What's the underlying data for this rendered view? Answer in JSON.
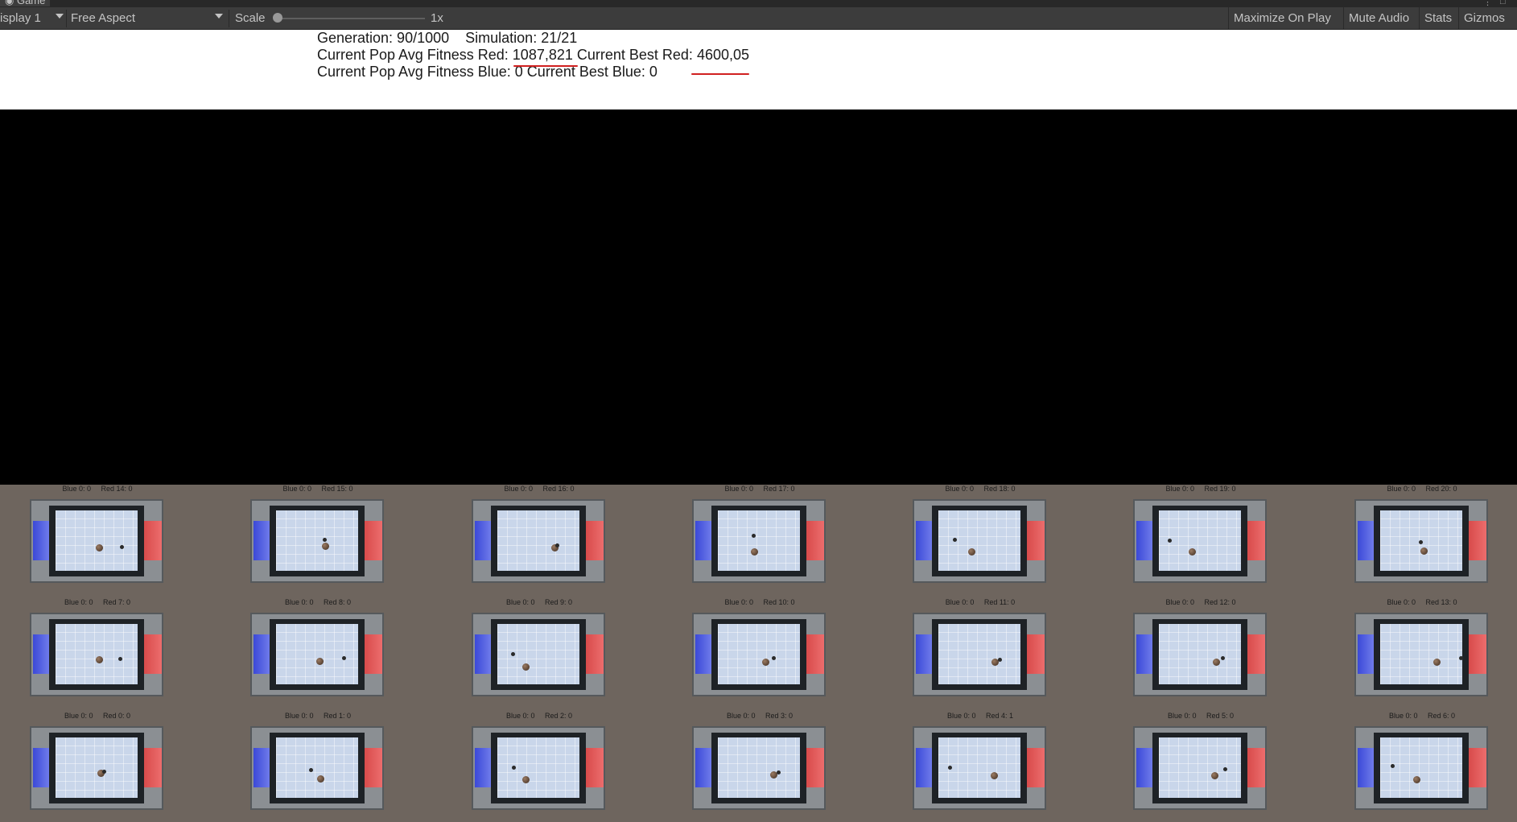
{
  "window": {
    "tab_title": "Game"
  },
  "toolbar": {
    "display": "isplay 1",
    "aspect": "Free Aspect",
    "scale_label": "Scale",
    "scale_value": "1x",
    "maximize_on_play": "Maximize On Play",
    "mute_audio": "Mute Audio",
    "stats": "Stats",
    "gizmos": "Gizmos"
  },
  "info": {
    "generation": "Generation: 90/1000",
    "simulation": "Simulation: 21/21",
    "line2_prefix": "Current Pop Avg Fitness Red: ",
    "avg_fitness_red": "1087,821",
    "line2_mid": " Current Best Red: ",
    "best_red": "4600,05",
    "line3": "Current Pop Avg Fitness Blue: 0 Current Best Blue: 0"
  },
  "colors": {
    "team_blue": "#3b49d8",
    "team_red": "#d84b4b",
    "annotation": "#d02020",
    "arena_bg": "#6e655e"
  },
  "arenas": [
    {
      "score": "Blue 0: 0     Red 14: 0"
    },
    {
      "score": "Blue 0: 0     Red 15: 0"
    },
    {
      "score": "Blue 0: 0     Red 16: 0"
    },
    {
      "score": "Blue 0: 0     Red 17: 0"
    },
    {
      "score": "Blue 0: 0     Red 18: 0"
    },
    {
      "score": "Blue 0: 0     Red 19: 0"
    },
    {
      "score": "Blue 0: 0     Red 20: 0"
    },
    {
      "score": "Blue 0: 0     Red 7: 0"
    },
    {
      "score": "Blue 0: 0     Red 8: 0"
    },
    {
      "score": "Blue 0: 0     Red 9: 0"
    },
    {
      "score": "Blue 0: 0     Red 10: 0"
    },
    {
      "score": "Blue 0: 0     Red 11: 0"
    },
    {
      "score": "Blue 0: 0     Red 12: 0"
    },
    {
      "score": "Blue 0: 0     Red 13: 0"
    },
    {
      "score": "Blue 0: 0     Red 0: 0"
    },
    {
      "score": "Blue 0: 0     Red 1: 0"
    },
    {
      "score": "Blue 0: 0     Red 2: 0"
    },
    {
      "score": "Blue 0: 0     Red 3: 0"
    },
    {
      "score": "Blue 0: 0     Red 4: 1"
    },
    {
      "score": "Blue 0: 0     Red 5: 0"
    },
    {
      "score": "Blue 0: 0     Red 6: 0"
    }
  ]
}
